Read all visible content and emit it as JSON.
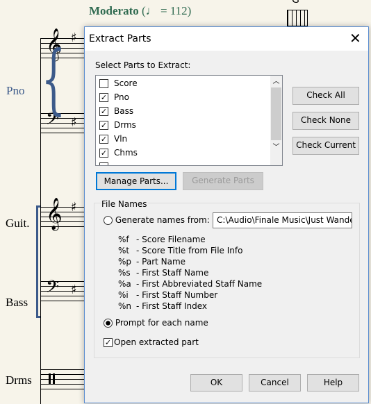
{
  "score": {
    "tempo": "Moderato",
    "tempo_value": "= 112",
    "chord": "G",
    "instruments": [
      "Pno",
      "Guit.",
      "Bass",
      "Drms"
    ]
  },
  "dialog": {
    "title": "Extract Parts",
    "select_label": "Select Parts to Extract:",
    "parts": [
      {
        "label": "Score",
        "checked": false
      },
      {
        "label": "Pno",
        "checked": true
      },
      {
        "label": "Bass",
        "checked": true
      },
      {
        "label": "Drms",
        "checked": true
      },
      {
        "label": "Vln",
        "checked": true
      },
      {
        "label": "Chms",
        "checked": true
      }
    ],
    "check_all": "Check All",
    "check_none": "Check None",
    "check_current": "Check Current",
    "manage_parts": "Manage Parts...",
    "generate_parts": "Generate Parts",
    "file_names_label": "File Names",
    "generate_names_label": "Generate names from:",
    "generate_names_value": "C:\\Audio\\Finale Music\\Just Wande",
    "codes": [
      {
        "code": "%f",
        "desc": "- Score Filename"
      },
      {
        "code": "%t",
        "desc": "- Score Title from File Info"
      },
      {
        "code": "%p",
        "desc": "- Part Name"
      },
      {
        "code": "%s",
        "desc": "- First Staff Name"
      },
      {
        "code": "%a",
        "desc": "- First Abbreviated Staff Name"
      },
      {
        "code": "%i",
        "desc": "- First Staff Number"
      },
      {
        "code": "%n",
        "desc": "- First Staff Index"
      }
    ],
    "prompt_label": "Prompt for each name",
    "prompt_selected": true,
    "open_label": "Open extracted part",
    "open_checked": true,
    "ok": "OK",
    "cancel": "Cancel",
    "help": "Help"
  }
}
